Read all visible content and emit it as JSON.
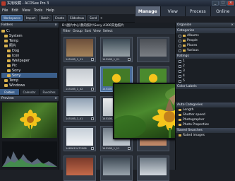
{
  "window": {
    "title": "实用收藏 - ACDSee Pro 3",
    "minimize": "_",
    "maximize": "□",
    "close": "×"
  },
  "menu": [
    "File",
    "Edit",
    "View",
    "Tools",
    "Help"
  ],
  "modes": [
    "Manage",
    "View",
    "Process",
    "Online"
  ],
  "active_mode": "Manage",
  "toolbar": {
    "items": [
      "Workspaces",
      "Import",
      "Batch",
      "Create",
      "Slideshow",
      "Send"
    ],
    "selected": "Workspaces",
    "expand": "»"
  },
  "folders": {
    "title": "Folders",
    "close": "×",
    "tree": [
      "C:",
      "System",
      "Temp",
      "照片",
      "Dog",
      "Icon",
      "Wallpaper",
      "Pic",
      "Sony",
      "Sony",
      "Temp",
      "Windows"
    ],
    "tabs": [
      "Folders",
      "Calendar",
      "Favorites"
    ],
    "active_tab": "Folders"
  },
  "preview": {
    "title": "Preview",
    "close": "×"
  },
  "browser": {
    "path": "D:\\图片中心\\我的照片\\Sony A300实拍照片",
    "filters": [
      "Filter",
      "Group",
      "Sort",
      "View",
      "Select"
    ],
    "thumbs": [
      {
        "label": "14510B_1_21"
      },
      {
        "label": "14510B_1_21"
      },
      {
        "label": ""
      },
      {
        "label": "14510B_1_42"
      },
      {
        "label": "14510B_1_42"
      },
      {
        "label": "14510B_1_1"
      },
      {
        "label": "14510B_1_41"
      },
      {
        "label": "14510B_1_41"
      },
      {
        "label": ""
      },
      {
        "label": "1462612472906"
      },
      {
        "label": "14510B_1_11"
      },
      {
        "label": ""
      },
      {
        "label": ""
      },
      {
        "label": ""
      },
      {
        "label": ""
      }
    ]
  },
  "organizer": {
    "title": "Organize",
    "close": "×",
    "categories_title": "Categories",
    "categories": [
      "Albums",
      "People",
      "Places",
      "Various"
    ],
    "ratings_title": "Ratings",
    "ratings": [
      "1",
      "2",
      "3",
      "4",
      "5"
    ],
    "color_labels_title": "Color Labels",
    "auto_title": "Auto Categories",
    "auto": [
      "Length",
      "Shutter speed",
      "Photographer",
      "Photo Properties"
    ],
    "saved_title": "Saved Searches",
    "saved": [
      "Rated images"
    ]
  }
}
